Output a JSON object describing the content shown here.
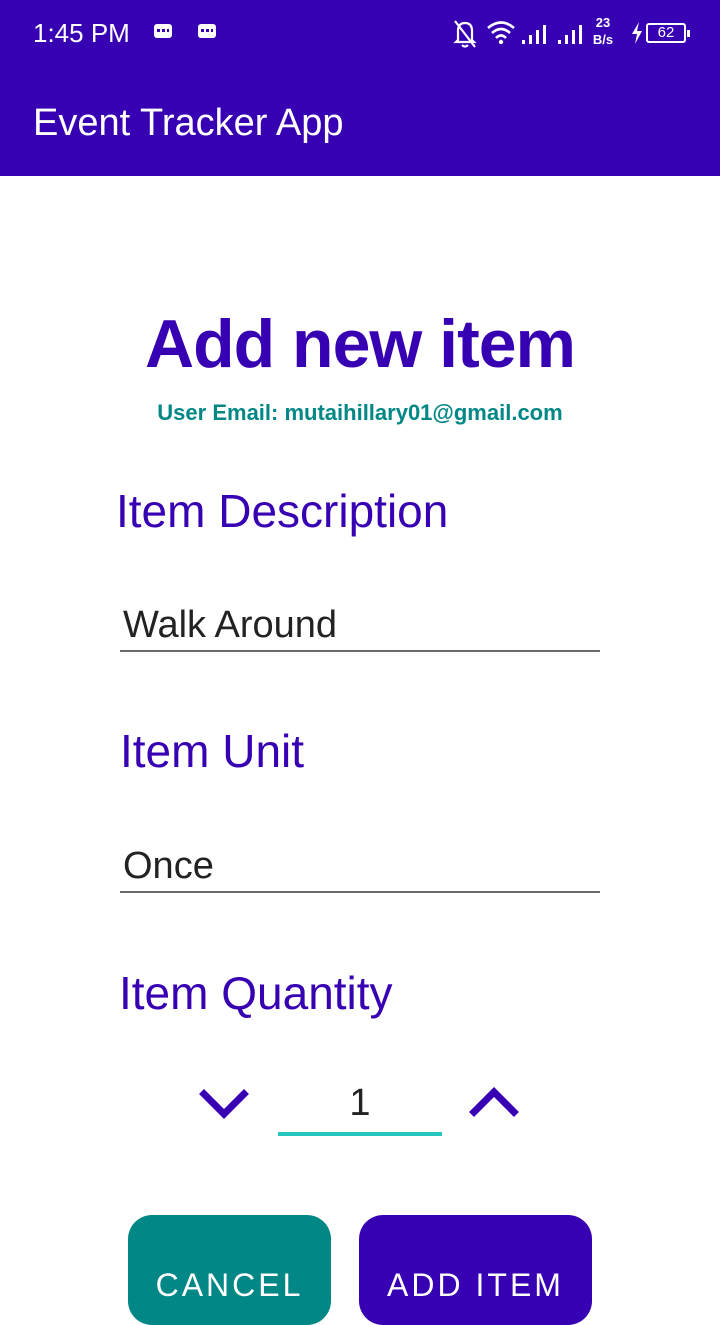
{
  "status_bar": {
    "time": "1:45 PM",
    "net_speed_value": "23",
    "net_speed_unit": "B/s",
    "battery_level": "62",
    "icons": [
      "message-icon",
      "message-icon",
      "bell-off-icon",
      "wifi-icon",
      "signal-icon",
      "signal-icon",
      "charging-icon",
      "battery-icon"
    ]
  },
  "app_bar": {
    "title": "Event Tracker App"
  },
  "form": {
    "title": "Add new item",
    "user_email": "User Email: mutaihillary01@gmail.com",
    "description_label": "Item Description",
    "description_value": "Walk Around",
    "unit_label": "Item Unit",
    "unit_value": "Once",
    "quantity_label": "Item Quantity",
    "quantity_value": "1",
    "decrement_icon": "chevron-down-icon",
    "increment_icon": "chevron-up-icon"
  },
  "actions": {
    "cancel_label": "CANCEL",
    "add_label": "ADD ITEM"
  },
  "colors": {
    "primary": "#3700B3",
    "secondary": "#018786",
    "quantity_underline": "#26C6C0"
  }
}
